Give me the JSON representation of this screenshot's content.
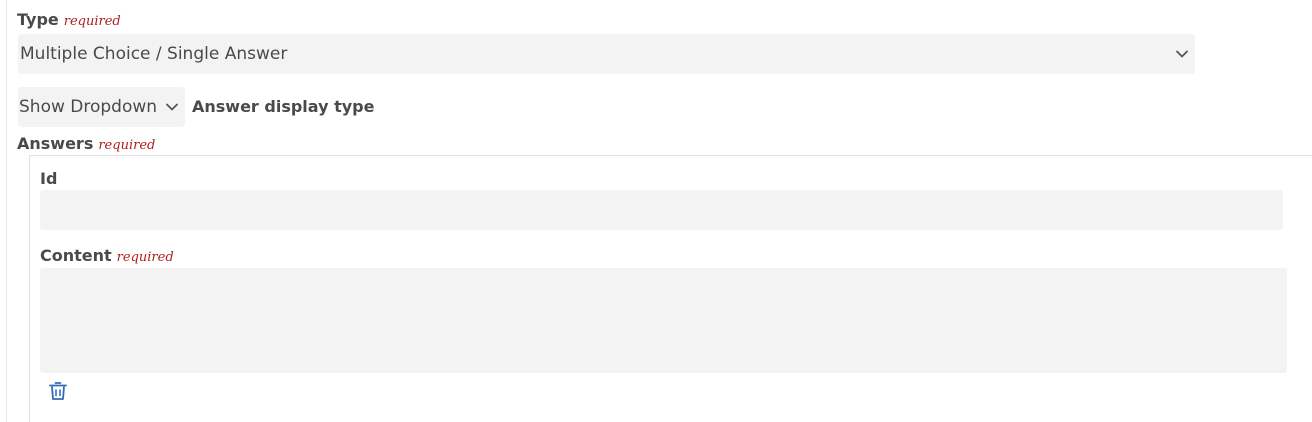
{
  "type_field": {
    "label": "Type",
    "required_label": "required",
    "selected_value": "Multiple Choice / Single Answer"
  },
  "display_type": {
    "selected_value": "Show Dropdown",
    "label": "Answer display type"
  },
  "answers": {
    "label": "Answers",
    "required_label": "required",
    "items": [
      {
        "id_label": "Id",
        "id_value": "",
        "content_label": "Content",
        "content_required_label": "required",
        "content_value": ""
      }
    ]
  },
  "icons": {
    "chevron": "chevron-down-icon",
    "delete": "trash-icon"
  },
  "colors": {
    "required": "#b01e1e",
    "field_bg": "#f3f3f3",
    "icon_accent": "#2f6fb5"
  }
}
